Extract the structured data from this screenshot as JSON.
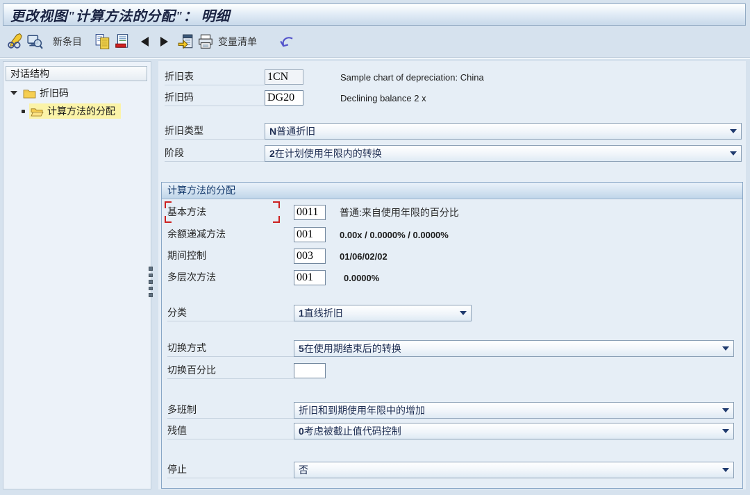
{
  "window": {
    "title": "更改视图\"计算方法的分配\"： 明细"
  },
  "toolbar": {
    "new_entries": "新条目",
    "variable_list": "变量清单",
    "icons": [
      "change-display-toggle",
      "display-view",
      "copy-entry",
      "delete-entry",
      "previous-entry",
      "next-entry",
      "worklist",
      "print",
      "undo"
    ]
  },
  "sidebar": {
    "header": "对话结构",
    "tree": [
      {
        "label": "折旧码"
      },
      {
        "label": "计算方法的分配"
      }
    ]
  },
  "main": {
    "key_fields": [
      {
        "label": "折旧表",
        "value": "1CN",
        "description": "Sample chart of depreciation: China"
      },
      {
        "label": "折旧码",
        "value": "DG20",
        "description": "Declining balance 2 x"
      }
    ],
    "dropdowns": [
      {
        "label": "折旧类型",
        "key": "N",
        "text": " 普通折旧"
      },
      {
        "label": "阶段",
        "key": "2",
        "text": " 在计划使用年限内的转换"
      }
    ],
    "groupbox": {
      "title": "计算方法的分配",
      "methods": [
        {
          "label": "基本方法",
          "value": "0011",
          "description": "普通:来自使用年限的百分比"
        },
        {
          "label": "余额递减方法",
          "value": "001",
          "description": "0.00x / 0.0000% / 0.0000%"
        },
        {
          "label": "期间控制",
          "value": "003",
          "description": "01/06/02/02"
        },
        {
          "label": "多层次方法",
          "value": "001",
          "description": "0.0000%"
        }
      ],
      "classification": {
        "label": "分类",
        "key": "1",
        "text": " 直线折旧"
      },
      "changeover_method": {
        "label": "切换方式",
        "key": "5",
        "text": " 在使用期结束后的转换"
      },
      "changeover_percent": {
        "label": "切换百分比",
        "value": ""
      },
      "multiple_shift": {
        "label": "多班制",
        "key": "",
        "text": "折旧和到期使用年限中的增加"
      },
      "scrap_value": {
        "label": "残值",
        "key": "0",
        "text": " 考虑被截止值代码控制"
      },
      "shutdown": {
        "label": "停止",
        "key": "",
        "text": "否"
      }
    }
  },
  "colors": {
    "selection_highlight": "#fbf3a8",
    "focus_bracket": "#cc2020",
    "dropdown_arrow": "#1f3a6e",
    "folder_icon": "#f6cf52"
  }
}
